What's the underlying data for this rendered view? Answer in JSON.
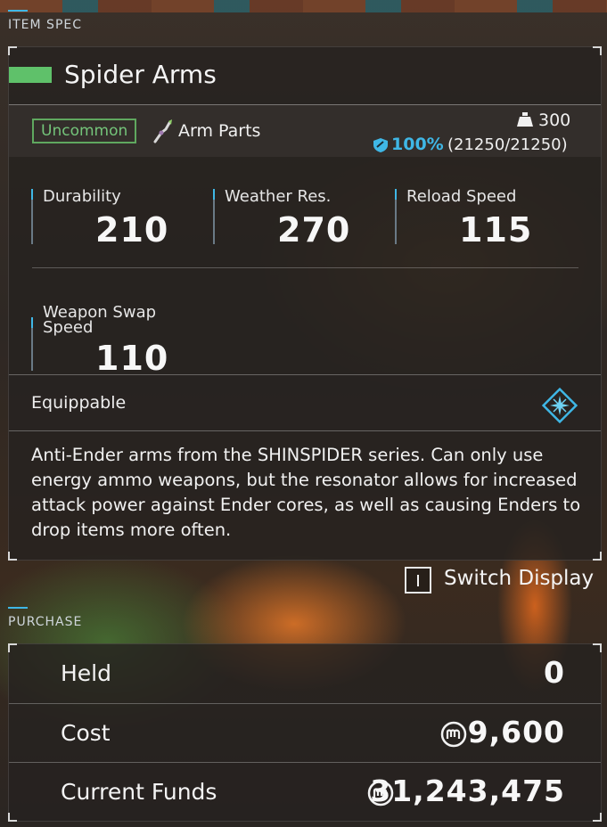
{
  "sections": {
    "item_spec": "ITEM SPEC",
    "purchase": "PURCHASE"
  },
  "item": {
    "name": "Spider Arms",
    "rarity": "Uncommon",
    "rarity_color": "#5fc16a",
    "category": "Arm Parts",
    "category_icon": "arm-part-icon",
    "weight": "300",
    "weight_icon": "weight-icon",
    "condition_percent": "100%",
    "condition_raw": "(21250/21250)",
    "condition_icon": "shield-icon"
  },
  "stats": [
    {
      "label": "Durability",
      "value": "210"
    },
    {
      "label": "Weather Res.",
      "value": "270"
    },
    {
      "label": "Reload Speed",
      "value": "115"
    },
    {
      "label": "Weapon Swap\nSpeed",
      "value": "110"
    }
  ],
  "equip": {
    "label": "Equippable",
    "icon": "resonator-star-icon"
  },
  "description": "Anti-Ender arms from the SHINSPIDER series. Can only use energy ammo weapons, but the resonator allows for increased attack power against Ender cores, as well as causing Enders to drop items more often.",
  "switch_display": {
    "key": "I",
    "label": "Switch Display"
  },
  "purchase": {
    "held_label": "Held",
    "held_value": "0",
    "cost_label": "Cost",
    "cost_value": "9,600",
    "funds_label": "Current Funds",
    "funds_value": "31,243,475",
    "currency_icon": "coin-icon"
  },
  "colors": {
    "accent": "#3fb7e6",
    "rarity_green": "#5fc16a"
  }
}
